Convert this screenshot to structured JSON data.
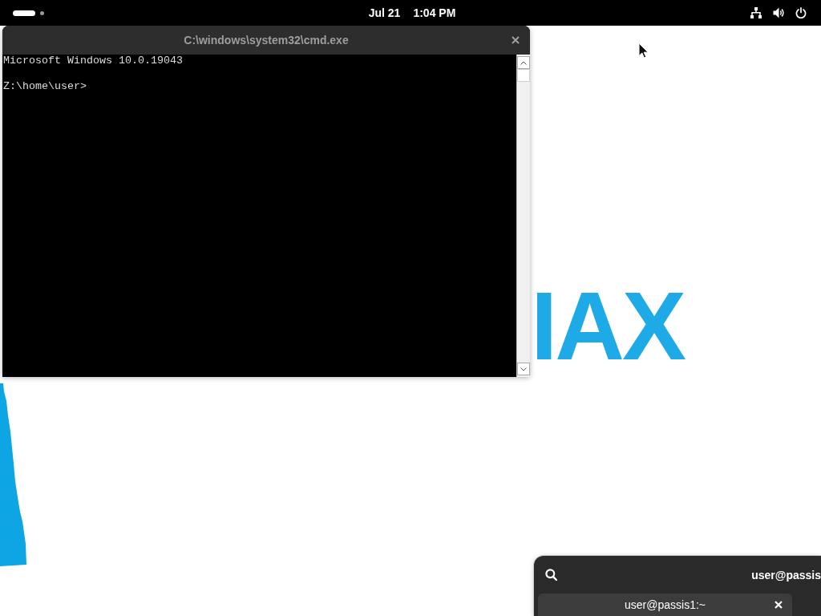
{
  "top_bar": {
    "workspaces": [
      {
        "selected": true
      },
      {
        "selected": false
      }
    ],
    "date": "Jul 21",
    "time": "1:04 PM"
  },
  "wallpaper": {
    "text": "IAX"
  },
  "cmd_window": {
    "title": "C:\\windows\\system32\\cmd.exe",
    "output": "Microsoft Windows 10.0.19043",
    "prompt": "Z:\\home\\user>"
  },
  "terminal_window": {
    "title": "user@passis",
    "tabs": [
      {
        "label": "user@passis1:~",
        "selected": true
      }
    ]
  }
}
